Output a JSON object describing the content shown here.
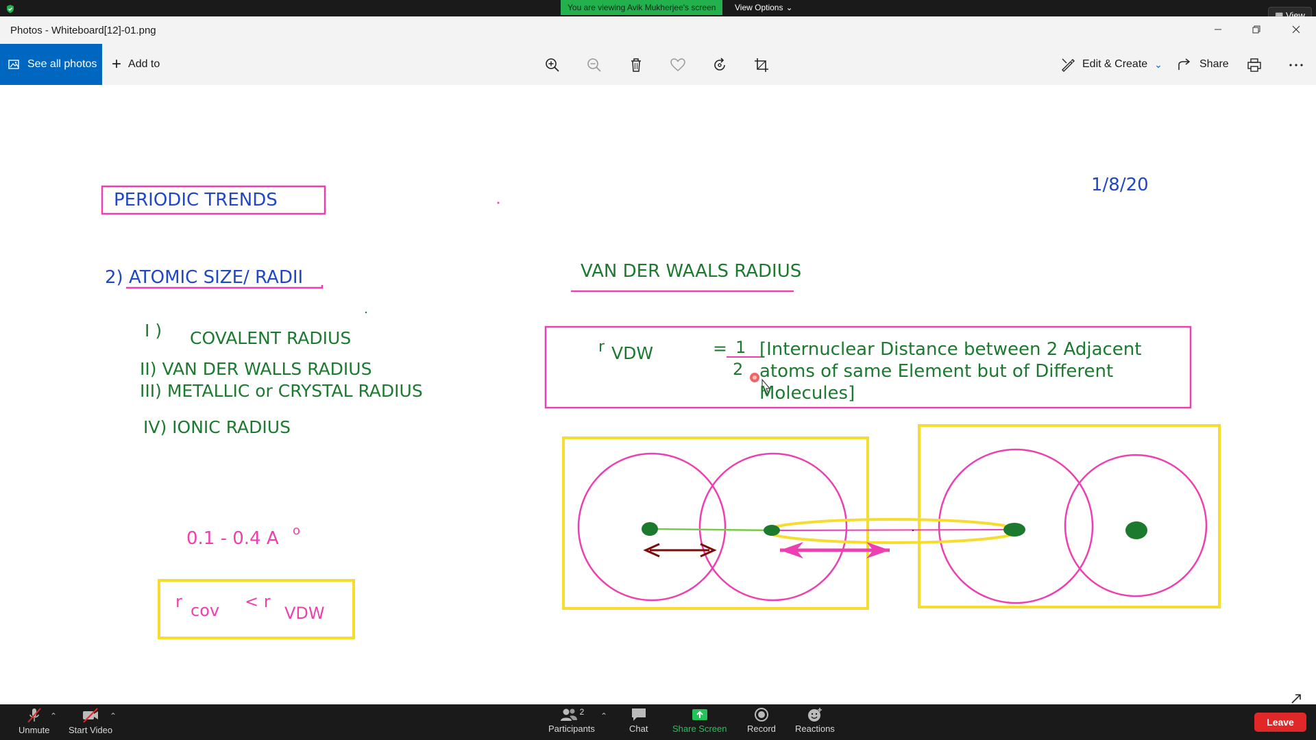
{
  "zoom_top": {
    "viewing_banner": "You are viewing Avik Mukherjee's screen",
    "view_options": "View Options",
    "view_button": "View"
  },
  "window": {
    "title": "Photos - Whiteboard[12]-01.png"
  },
  "toolbar": {
    "see_all_photos": "See all photos",
    "add_to": "Add to",
    "icons": [
      "zoom-in-icon",
      "zoom-out-icon",
      "delete-icon",
      "favorite-icon",
      "rotate-icon",
      "crop-icon"
    ],
    "edit_create": "Edit & Create",
    "share": "Share"
  },
  "whiteboard": {
    "title": "PERIODIC TRENDS",
    "date": "1/8/20",
    "section_heading": "2) ATOMIC SIZE/ RADII",
    "list": [
      "I )",
      "COVALENT RADIUS",
      "II) VAN DER WALLS RADIUS",
      "III) METALLIC or CRYSTAL  RADIUS",
      "IV) IONIC RADIUS"
    ],
    "range_text": "0.1 - 0.4 A",
    "range_sup": "o",
    "comparison": {
      "r1": "r",
      "sub1": "cov",
      "lt": "< r",
      "sub2": "VDW"
    },
    "vdw_heading": "VAN DER WAALS RADIUS",
    "formula": {
      "r": "r",
      "sub": "VDW",
      "eq": "=",
      "num": "1",
      "den": "2",
      "line1": "[Internuclear Distance between  2 Adjacent",
      "line2": "atoms of same Element but of Different",
      "line3": "Molecules]"
    },
    "colors": {
      "blue": "#1f47c6",
      "green": "#1b7a2e",
      "pink": "#ee3fb1",
      "yellow": "#f6dc2e"
    }
  },
  "zoom_bottom": {
    "unmute": "Unmute",
    "start_video": "Start Video",
    "participants": "Participants",
    "participant_count": "2",
    "chat": "Chat",
    "share_screen": "Share Screen",
    "record": "Record",
    "reactions": "Reactions",
    "leave": "Leave"
  }
}
